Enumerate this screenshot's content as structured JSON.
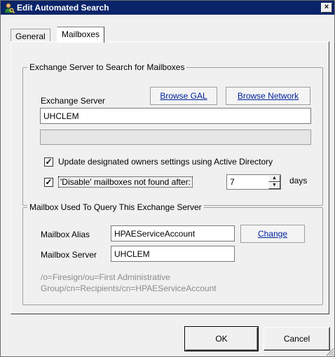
{
  "window": {
    "title": "Edit Automated Search",
    "close_label": "×"
  },
  "tabs": [
    {
      "label": "General"
    },
    {
      "label": "Mailboxes"
    }
  ],
  "exchange_group": {
    "title": "Exchange Server to Search for Mailboxes",
    "server_label": "Exchange Server",
    "browse_gal": "Browse GAL",
    "browse_network": "Browse Network",
    "server_value": "UHCLEM",
    "update_owners_label": "Update designated owners settings using Active Directory",
    "update_owners_checked": true,
    "disable_label": "'Disable' mailboxes not found after:",
    "disable_checked": true,
    "days_value": "7",
    "days_label": "days"
  },
  "mailbox_group": {
    "title": "Mailbox Used To Query This Exchange Server",
    "alias_label": "Mailbox Alias",
    "alias_value": "HPAEServiceAccount",
    "change_label": "Change",
    "server_label": "Mailbox Server",
    "server_value": "UHCLEM",
    "dn_line1": "/o=Firesign/ou=First Administrative",
    "dn_line2": "Group/cn=Recipients/cn=HPAEServiceAccount"
  },
  "buttons": {
    "ok": "OK",
    "cancel": "Cancel"
  },
  "icons": {
    "app": "user-search-icon",
    "close": "close-icon",
    "spin_up": "spin-up-icon",
    "spin_down": "spin-down-icon",
    "grip": "resize-grip-icon"
  },
  "colors": {
    "titlebar": "#0a246a",
    "link": "#00239c",
    "face": "#f0f0f0"
  }
}
